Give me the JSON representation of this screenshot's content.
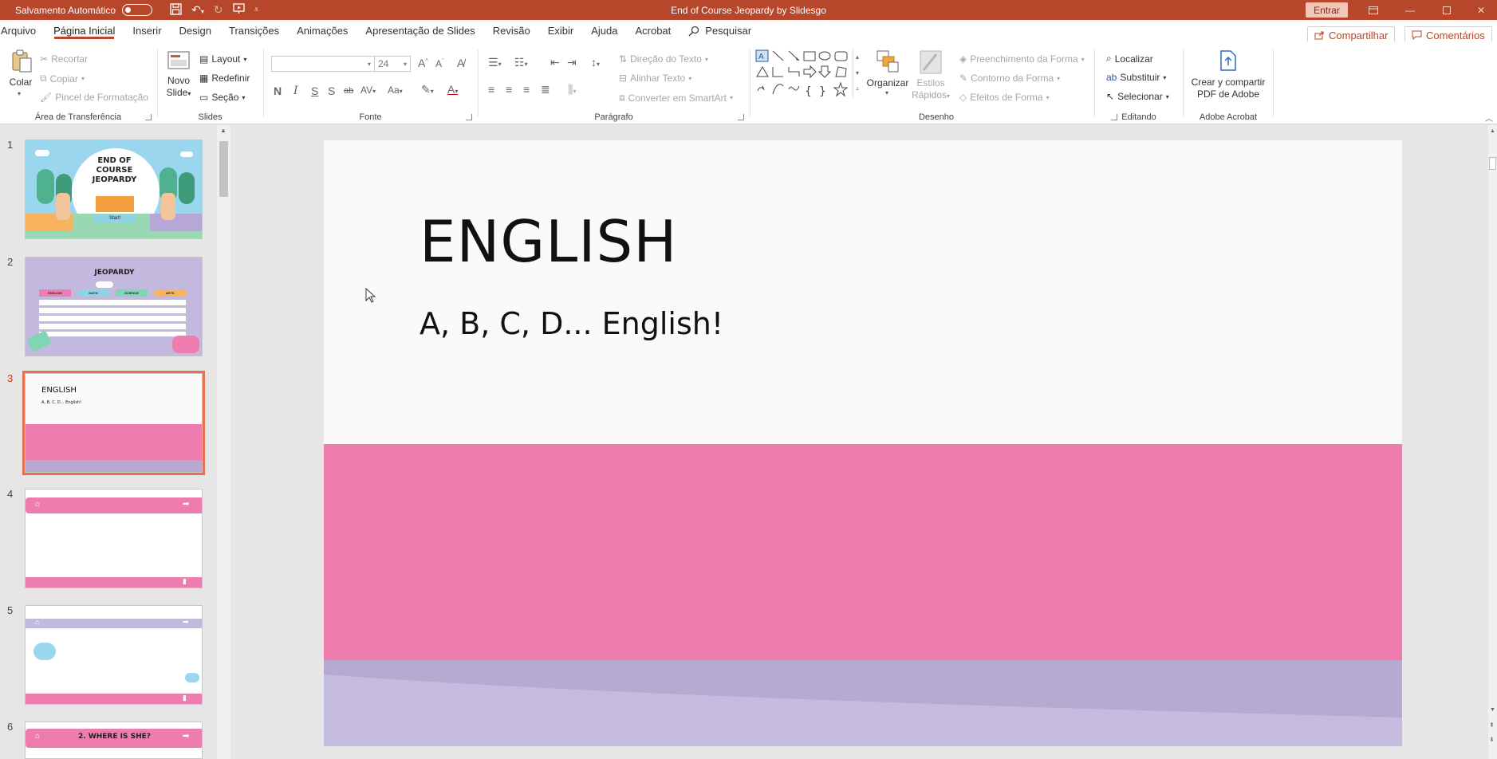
{
  "titlebar": {
    "autosave_label": "Salvamento Automático",
    "doc_title": "End of Course Jeopardy by Slidesgo",
    "signin_label": "Entrar"
  },
  "menu": {
    "items": [
      "Arquivo",
      "Página Inicial",
      "Inserir",
      "Design",
      "Transições",
      "Animações",
      "Apresentação de Slides",
      "Revisão",
      "Exibir",
      "Ajuda",
      "Acrobat"
    ],
    "active": "Página Inicial",
    "search_label": "Pesquisar",
    "share_label": "Compartilhar",
    "comments_label": "Comentários"
  },
  "ribbon": {
    "clipboard": {
      "paste": "Colar",
      "cut": "Recortar",
      "copy": "Copiar",
      "format_painter": "Pincel de Formatação",
      "label": "Área de Transferência"
    },
    "slides": {
      "new_slide_line1": "Novo",
      "new_slide_line2": "Slide",
      "layout": "Layout",
      "reset": "Redefinir",
      "section": "Seção",
      "label": "Slides"
    },
    "font": {
      "font_name": "",
      "font_size": "24",
      "bold": "N",
      "italic": "I",
      "underline": "S",
      "shadow": "S",
      "strike": "ab",
      "spacing": "AV",
      "case": "Aa",
      "grow": "A",
      "shrink": "A",
      "label": "Fonte"
    },
    "paragraph": {
      "text_direction": "Direção do Texto",
      "align_text": "Alinhar Texto",
      "smartart": "Converter em SmartArt",
      "label": "Parágrafo"
    },
    "drawing": {
      "arrange": "Organizar",
      "quick_styles_line1": "Estilos",
      "quick_styles_line2": "Rápidos",
      "shape_fill": "Preenchimento da Forma",
      "shape_outline": "Contorno da Forma",
      "shape_effects": "Efeitos de Forma",
      "label": "Desenho"
    },
    "editing": {
      "find": "Localizar",
      "replace": "Substituir",
      "select": "Selecionar",
      "label": "Editando"
    },
    "acrobat": {
      "create_line1": "Crear y compartir",
      "create_line2": "PDF de Adobe",
      "label": "Adobe Acrobat"
    }
  },
  "thumbnails": [
    {
      "num": "1",
      "title_lines": [
        "END OF",
        "COURSE",
        "JEOPARDY"
      ],
      "button": "Start!"
    },
    {
      "num": "2",
      "title": "JEOPARDY",
      "categories": [
        "ENGLISH",
        "MATH",
        "SCIENCE",
        "ARTS"
      ]
    },
    {
      "num": "3",
      "title": "ENGLISH",
      "subtitle": "A, B, C, D... English!"
    },
    {
      "num": "4"
    },
    {
      "num": "5"
    },
    {
      "num": "6",
      "title": "2. WHERE IS SHE?"
    }
  ],
  "active_slide": "3",
  "slide": {
    "title": "ENGLISH",
    "subtitle": "A, B, C, D... English!"
  },
  "colors": {
    "accent": "#b7472a",
    "pink": "#ef7caf",
    "lavender": "#b7aad2"
  }
}
